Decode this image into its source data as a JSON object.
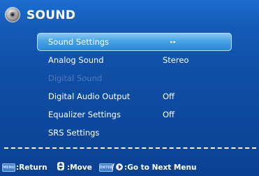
{
  "title": "SOUND",
  "menu": {
    "items": [
      {
        "label": "Sound Settings",
        "value": "",
        "state": "selected"
      },
      {
        "label": "Analog Sound",
        "value": "Stereo",
        "state": "normal"
      },
      {
        "label": "Digital Sound",
        "value": "",
        "state": "disabled"
      },
      {
        "label": "Digital Audio Output",
        "value": "Off",
        "state": "normal"
      },
      {
        "label": "Equalizer Settings",
        "value": "Off",
        "state": "normal"
      },
      {
        "label": "SRS Settings",
        "value": "",
        "state": "normal"
      }
    ],
    "selected_indicator": "▸▸"
  },
  "footer": {
    "menu_key": "MENU",
    "return_label": ":Return",
    "move_label": ":Move",
    "enter_key": "ENTER",
    "next_label": ":Go to Next Menu",
    "slash": "/"
  },
  "icons": {
    "title": "speaker-knob-icon",
    "updown": "up-down-arrows-icon",
    "play": "play-arrow-icon"
  },
  "colors": {
    "background": "#0f4fa6",
    "selection": "#47a4e6",
    "disabled_text": "#4f7bbd"
  }
}
